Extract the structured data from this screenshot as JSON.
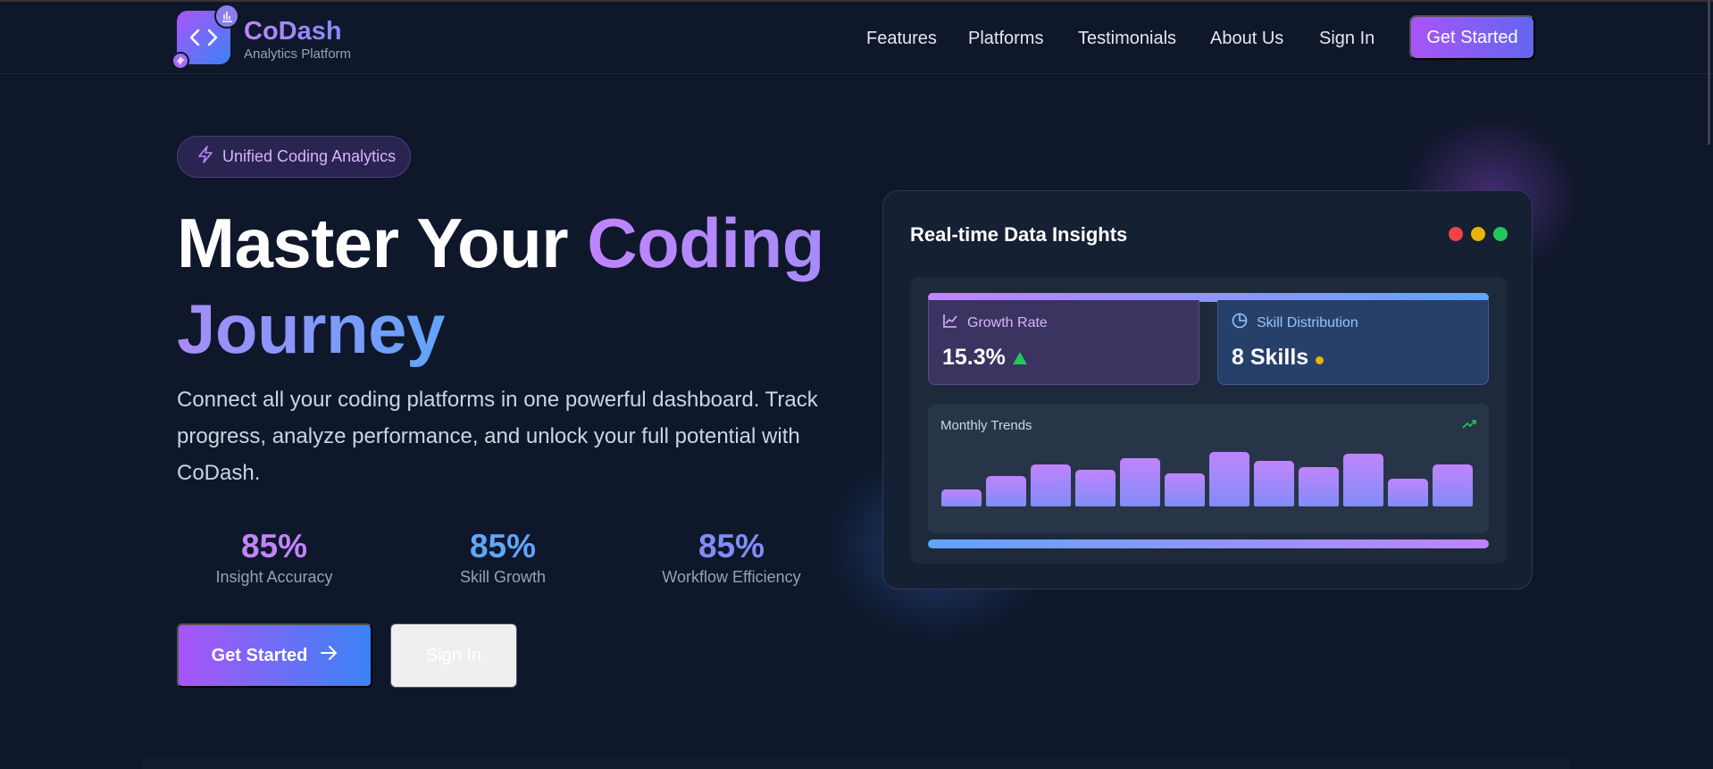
{
  "brand": {
    "name": "CoDash",
    "tagline": "Analytics Platform"
  },
  "nav": {
    "links": [
      "Features",
      "Platforms",
      "Testimonials",
      "About Us",
      "Sign In"
    ],
    "cta": "Get Started"
  },
  "hero": {
    "badge": "Unified Coding Analytics",
    "headline": {
      "part1": "Master Your ",
      "part2": "Coding",
      "part3": "Journey"
    },
    "lead": "Connect all your coding platforms in one powerful dashboard. Track progress, analyze performance, and unlock your full potential with CoDash.",
    "stats": [
      {
        "value": "85%",
        "label": "Insight Accuracy",
        "color": "#c084fc"
      },
      {
        "value": "85%",
        "label": "Skill Growth",
        "color": "#60a5fa"
      },
      {
        "value": "85%",
        "label": "Workflow Efficiency",
        "color": "#818cf8"
      }
    ],
    "primary_button": "Get Started",
    "secondary_button": "Sign In"
  },
  "insights_card": {
    "title": "Real-time Data Insights",
    "window_dots": [
      "#ef4444",
      "#eab308",
      "#22c55e"
    ],
    "growth": {
      "label": "Growth Rate",
      "value": "15.3%",
      "trend": "up"
    },
    "skills": {
      "label": "Skill Distribution",
      "value": "8 Skills"
    },
    "trends": {
      "title": "Monthly Trends",
      "bar_values": [
        0.25,
        0.45,
        0.63,
        0.54,
        0.72,
        0.49,
        0.82,
        0.68,
        0.59,
        0.78,
        0.41,
        0.63
      ]
    }
  },
  "colors": {
    "accent_purple": "#a855f7",
    "accent_blue": "#3b82f6",
    "background": "#0f172a"
  }
}
